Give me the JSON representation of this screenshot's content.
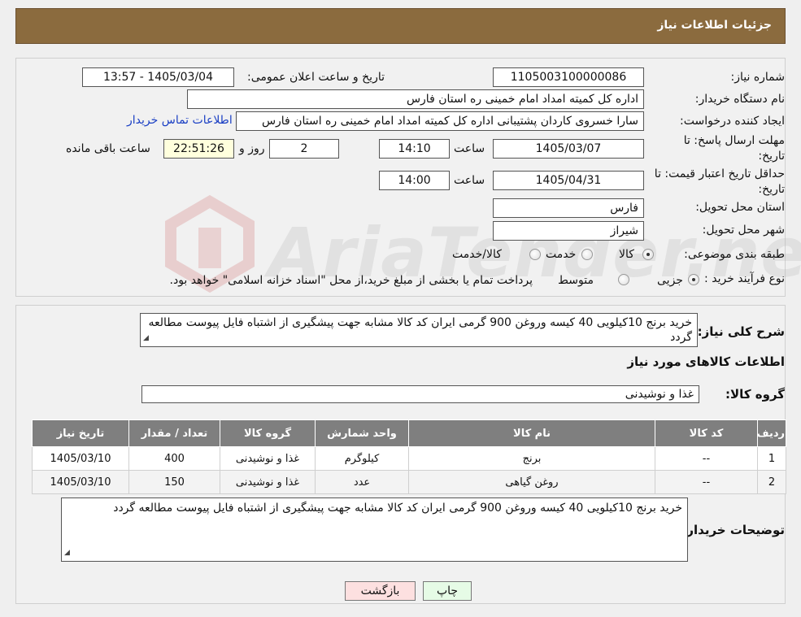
{
  "header": {
    "title": "جزئیات اطلاعات نیاز"
  },
  "watermark": {
    "text": "AriaTender.neT"
  },
  "form": {
    "need_number_label": "شماره نیاز:",
    "need_number": "1105003100000086",
    "announce_label": "تاریخ و ساعت اعلان عمومی:",
    "announce_value": "1405/03/04 - 13:57",
    "buyer_org_label": "نام دستگاه خریدار:",
    "buyer_org": "اداره کل کمیته امداد امام خمینی  ره  استان فارس",
    "requester_label": "ایجاد کننده درخواست:",
    "requester": "سارا خسروی کاردان پشتیبانی  اداره کل کمیته امداد امام خمینی  ره  استان فارس",
    "contact_link": "اطلاعات تماس خریدار",
    "deadline_label_1": "مهلت ارسال پاسخ: تا",
    "deadline_label_2": "تاریخ:",
    "deadline_date": "1405/03/07",
    "time_label": "ساعت",
    "deadline_time": "14:10",
    "days_value": "2",
    "days_label": "روز و",
    "remaining_time": "22:51:26",
    "remaining_label": "ساعت باقی مانده",
    "validity_label_1": "حداقل تاریخ اعتبار قیمت: تا",
    "validity_label_2": "تاریخ:",
    "validity_date": "1405/04/31",
    "validity_time_label": "ساعت",
    "validity_time": "14:00",
    "province_label": "استان محل تحویل:",
    "province": "فارس",
    "city_label": "شهر محل تحویل:",
    "city": "شیراز",
    "category_label": "طبقه بندی موضوعی:",
    "category_options": [
      "کالا",
      "خدمت",
      "کالا/خدمت"
    ],
    "category_selected": "کالا",
    "process_label": "نوع فرآیند خرید :",
    "process_options": [
      "جزیی",
      "متوسط"
    ],
    "process_selected": "جزیی",
    "process_note": "پرداخت تمام یا بخشی از مبلغ خرید،از محل \"اسناد خزانه اسلامی\" خواهد بود."
  },
  "summary": {
    "label": "شرح کلی نیاز:",
    "text": "خرید برنج 10کیلویی 40 کیسه وروغن 900 گرمی ایران کد کالا مشابه جهت پیشگیری از اشتباه فایل پیوست مطالعه گردد",
    "goods_info_title": "اطلاعات کالاهای مورد نیاز",
    "group_label": "گروه کالا:",
    "group_value": "غذا و نوشیدنی"
  },
  "table": {
    "headers": [
      "ردیف",
      "کد کالا",
      "نام کالا",
      "واحد شمارش",
      "گروه کالا",
      "تعداد / مقدار",
      "تاریخ نیاز"
    ],
    "rows": [
      [
        "1",
        "--",
        "برنج",
        "کیلوگرم",
        "غذا و نوشیدنی",
        "400",
        "1405/03/10"
      ],
      [
        "2",
        "--",
        "روغن گیاهی",
        "عدد",
        "غذا و نوشیدنی",
        "150",
        "1405/03/10"
      ]
    ]
  },
  "notes": {
    "label": "توضیحات خریدار:",
    "text": "خرید برنج 10کیلویی 40 کیسه وروغن 900 گرمی ایران کد کالا مشابه جهت پیشگیری از اشتباه فایل پیوست مطالعه گردد"
  },
  "buttons": {
    "print": "چاپ",
    "back": "بازگشت"
  },
  "colors": {
    "header_bg": "#8b6b3e",
    "table_header_bg": "#7f7f7f",
    "back_button_bg": "#fde0e0",
    "print_button_bg": "#e6fbe6"
  }
}
